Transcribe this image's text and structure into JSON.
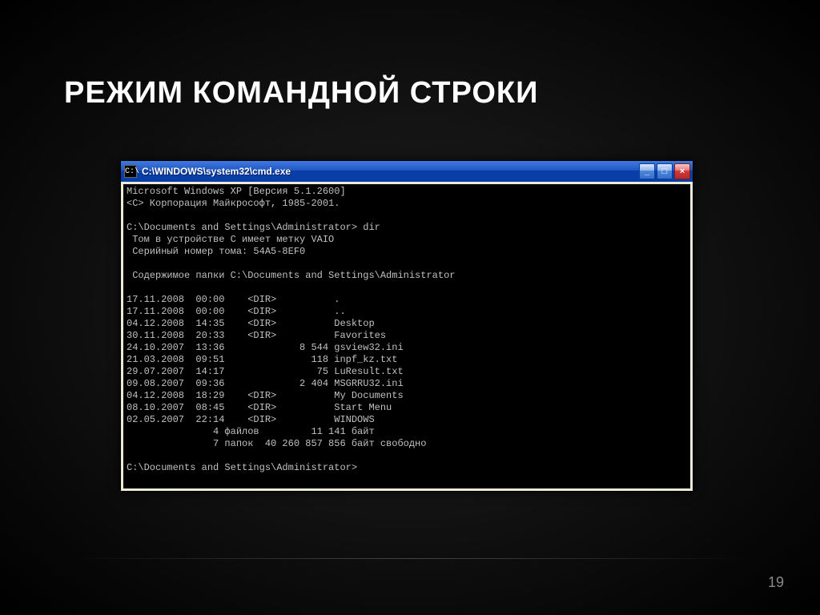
{
  "slide": {
    "title": "РЕЖИМ КОМАНДНОЙ СТРОКИ",
    "page_number": "19"
  },
  "window": {
    "icon_char": "C:\\",
    "title": "C:\\WINDOWS\\system32\\cmd.exe",
    "btn_min": "_",
    "btn_max": "□",
    "btn_close": "×"
  },
  "terminal": {
    "lines": [
      "Microsoft Windows XP [Версия 5.1.2600]",
      "<C> Корпорация Майкрософт, 1985-2001.",
      "",
      "C:\\Documents and Settings\\Administrator> dir",
      " Том в устройстве C имеет метку VAIO",
      " Серийный номер тома: 54A5-8EF0",
      "",
      " Содержимое папки C:\\Documents and Settings\\Administrator",
      "",
      "17.11.2008  00:00    <DIR>          .",
      "17.11.2008  00:00    <DIR>          ..",
      "04.12.2008  14:35    <DIR>          Desktop",
      "30.11.2008  20:33    <DIR>          Favorites",
      "24.10.2007  13:36             8 544 gsview32.ini",
      "21.03.2008  09:51               118 inpf_kz.txt",
      "29.07.2007  14:17                75 LuResult.txt",
      "09.08.2007  09:36             2 404 MSGRRU32.ini",
      "04.12.2008  18:29    <DIR>          My Documents",
      "08.10.2007  08:45    <DIR>          Start Menu",
      "02.05.2007  22:14    <DIR>          WINDOWS",
      "               4 файлов         11 141 байт",
      "               7 папок  40 260 857 856 байт свободно",
      "",
      "C:\\Documents and Settings\\Administrator>"
    ]
  }
}
